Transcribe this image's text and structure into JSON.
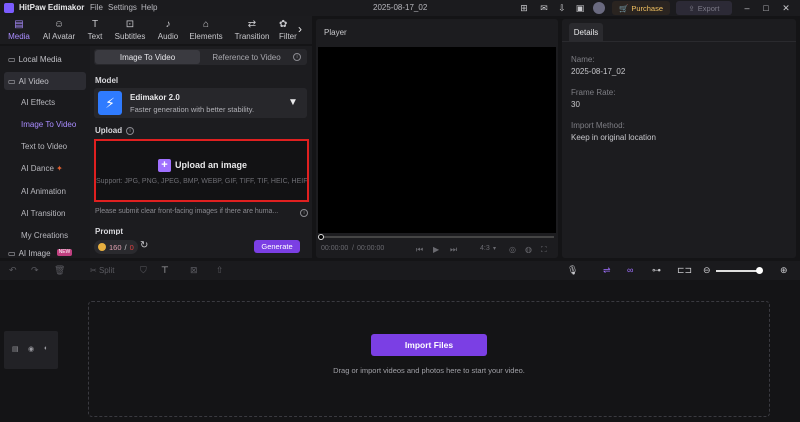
{
  "app": {
    "title": "HitPaw Edimakor",
    "menu": [
      "File",
      "Settings",
      "Help"
    ],
    "project_title": "2025-08-17_02",
    "purchase_label": "Purchase",
    "export_label": "Export"
  },
  "toolbar": {
    "items": [
      {
        "label": "Media",
        "icon": "media-icon"
      },
      {
        "label": "AI Avatar",
        "icon": "ai-avatar-icon"
      },
      {
        "label": "Text",
        "icon": "text-icon"
      },
      {
        "label": "Subtitles",
        "icon": "subtitles-icon"
      },
      {
        "label": "Audio",
        "icon": "audio-icon"
      },
      {
        "label": "Elements",
        "icon": "elements-icon"
      },
      {
        "label": "Transition",
        "icon": "transition-icon"
      },
      {
        "label": "Filter",
        "icon": "filter-icon"
      }
    ]
  },
  "sidebar": {
    "local_media": "Local Media",
    "ai_video": "AI Video",
    "items": [
      "AI Effects",
      "Image To Video",
      "Text to Video",
      "AI Dance",
      "AI Animation",
      "AI Transition",
      "My Creations",
      "AI Image"
    ],
    "new_badge": "NEW"
  },
  "panel": {
    "tab_active": "Image To Video",
    "tab_inactive": "Reference to Video",
    "model_label": "Model",
    "model_name": "Edimakor 2.0",
    "model_desc": "Faster generation with better stability.",
    "upload_label": "Upload",
    "upload_title": "Upload an image",
    "upload_support": "Support: JPG, PNG, JPEG, BMP, WEBP, GIF, TIFF, TIF, HEIC, HEIF",
    "hint": "Please submit clear front-facing images if there are huma...",
    "prompt_label": "Prompt",
    "credits_used": "160",
    "credits_sep": "/",
    "credits_total": "0",
    "generate_label": "Generate"
  },
  "player": {
    "title": "Player",
    "time_current": "00:00:00",
    "time_total": "00:00:00",
    "aspect": "4:3"
  },
  "details": {
    "tab": "Details",
    "fields": [
      {
        "label": "Name:",
        "value": "2025-08-17_02"
      },
      {
        "label": "Frame Rate:",
        "value": "30"
      },
      {
        "label": "Import Method:",
        "value": "Keep in original location"
      }
    ]
  },
  "timeline": {
    "split_label": "Split",
    "import_label": "Import Files",
    "drag_hint": "Drag or import videos and photos here to start your video.",
    "zoom_level": 0.9
  },
  "colors": {
    "accent": "#7b3fe4",
    "highlight_border": "#e02020",
    "active_text": "#a98cff"
  }
}
